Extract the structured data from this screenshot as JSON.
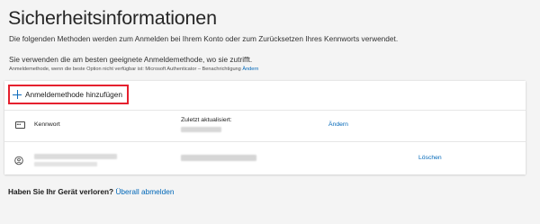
{
  "page": {
    "title": "Sicherheitsinformationen",
    "description": "Die folgenden Methoden werden zum Anmelden bei Ihrem Konto oder zum Zurücksetzen Ihres Kennworts verwendet.",
    "recommendation": "Sie verwenden die am besten geeignete Anmeldemethode, wo sie zutrifft.",
    "default_method_text": "Anmeldemethode, wenn die beste Option nicht verfügbar ist: Microsoft Authenticator – Benachrichtigung",
    "default_method_link": "Ändern"
  },
  "methods": {
    "add_button_label": "Anmeldemethode hinzufügen",
    "rows": [
      {
        "icon": "password-icon",
        "label": "Kennwort",
        "updated_label": "Zuletzt aktualisiert:",
        "action": "Ändern"
      },
      {
        "icon": "authenticator-icon",
        "action": "Löschen"
      }
    ]
  },
  "footer": {
    "question": "Haben Sie Ihr Gerät verloren?",
    "link": "Überall abmelden"
  },
  "colors": {
    "link": "#0067b8",
    "highlight_border": "#e5202e",
    "background": "#f4f4f4"
  }
}
